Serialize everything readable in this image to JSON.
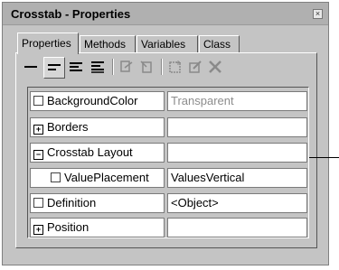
{
  "window": {
    "title": "Crosstab - Properties",
    "close_glyph": "×"
  },
  "tabs": [
    {
      "label": "Properties",
      "active": true
    },
    {
      "label": "Methods",
      "active": false
    },
    {
      "label": "Variables",
      "active": false
    },
    {
      "label": "Class",
      "active": false
    }
  ],
  "toolbar": {
    "icons": [
      "align-line-icon",
      "align-left-icon",
      "align-center-icon",
      "align-right-icon",
      "link-icon",
      "unlink-icon",
      "new-item-icon",
      "edit-item-icon",
      "delete-icon"
    ]
  },
  "properties": [
    {
      "name": "BackgroundColor",
      "value": "Transparent",
      "marker": "check",
      "indent": false,
      "value_muted": true
    },
    {
      "name": "Borders",
      "value": "",
      "marker": "plus",
      "indent": false,
      "value_muted": false
    },
    {
      "name": "Crosstab Layout",
      "value": "",
      "marker": "minus",
      "indent": false,
      "value_muted": false
    },
    {
      "name": "ValuePlacement",
      "value": "ValuesVertical",
      "marker": "check",
      "indent": true,
      "value_muted": false
    },
    {
      "name": "Definition",
      "value": "<Object>",
      "marker": "check",
      "indent": false,
      "value_muted": false
    },
    {
      "name": "Position",
      "value": "",
      "marker": "plus",
      "indent": false,
      "value_muted": false
    }
  ],
  "markers": {
    "plus": "+",
    "minus": "−"
  }
}
